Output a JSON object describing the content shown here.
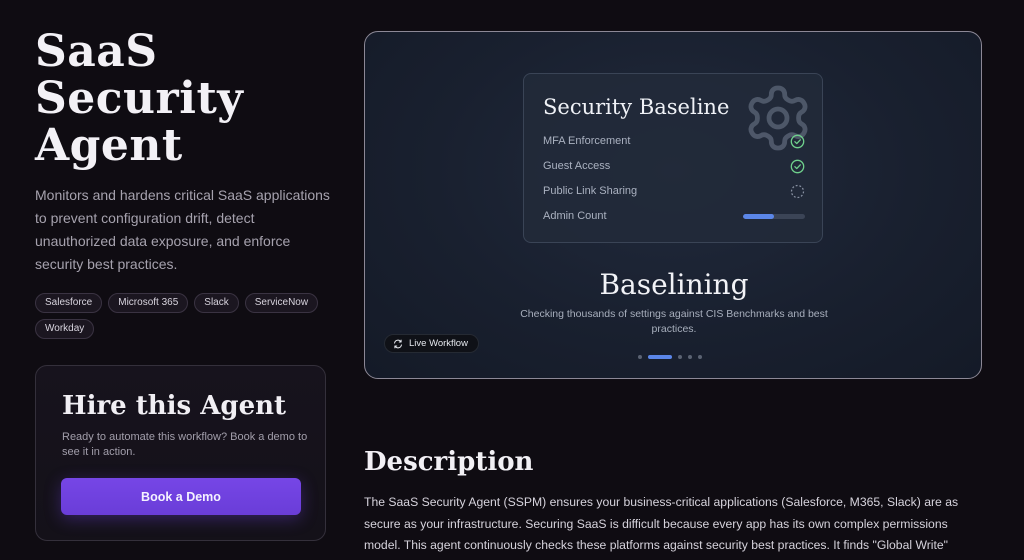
{
  "hero": {
    "title": "SaaS Security Agent",
    "description": "Monitors and hardens critical SaaS applications to prevent configuration drift, detect unauthorized data exposure, and enforce security best practices."
  },
  "tags": [
    "Salesforce",
    "Microsoft 365",
    "Slack",
    "ServiceNow",
    "Workday"
  ],
  "hire_card": {
    "title": "Hire this Agent",
    "subtitle": "Ready to automate this workflow? Book a demo to see it in action.",
    "button_label": "Book a Demo"
  },
  "workflow": {
    "card_title": "Security Baseline",
    "card_icon": "gear-icon",
    "checks": [
      {
        "label": "MFA Enforcement",
        "status": "passed",
        "icon": "check-circle-icon"
      },
      {
        "label": "Guest Access",
        "status": "passed",
        "icon": "check-circle-icon"
      },
      {
        "label": "Public Link Sharing",
        "status": "pending",
        "icon": "dashed-circle-icon"
      },
      {
        "label": "Admin Count",
        "status": "progress",
        "progress": 0.5
      }
    ],
    "stage_title": "Baselining",
    "stage_description": "Checking thousands of settings against CIS Benchmarks and best practices.",
    "badge_label": "Live Workflow",
    "badge_icon": "refresh-icon",
    "steps_total": 5,
    "active_step": 2
  },
  "description": {
    "title": "Description",
    "body": "The SaaS Security Agent (SSPM) ensures your business-critical applications (Salesforce, M365, Slack) are as secure as your infrastructure. Securing SaaS is difficult because every app has its own complex permissions model. This agent continuously checks these platforms against security best practices. It finds \"Global Write\" permissions in Salesforce, \"External Sharing\" links in SharePoint that shouldn't exist, or Slack channels where sensitive files are"
  },
  "colors": {
    "background": "#0f0c12",
    "accent_purple": "#7646e6",
    "accent_blue": "#5b86e8",
    "success_green": "#6fd08c"
  }
}
